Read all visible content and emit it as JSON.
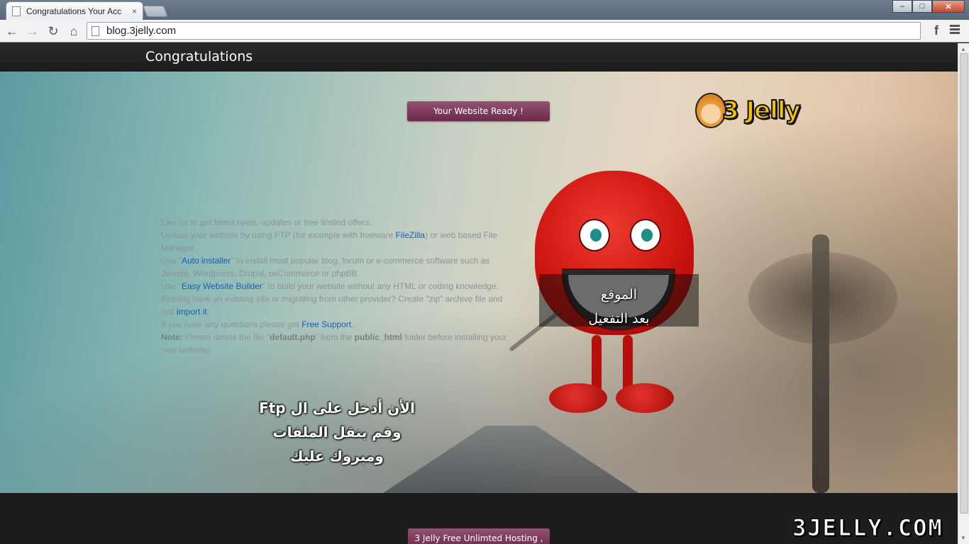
{
  "browser": {
    "tab_title": "Congratulations Your Acc",
    "tab_close": "×",
    "url": "blog.3jelly.com",
    "facebook_icon": "f",
    "window_buttons": {
      "minimize": "–",
      "maximize": "□",
      "close": "✕"
    },
    "nav": {
      "back": "←",
      "forward": "→",
      "reload": "↻",
      "home": "⌂"
    }
  },
  "header": {
    "title": "Congratulations"
  },
  "hero": {
    "ready_button": "Your Website Ready !",
    "logo_text": "3 Jelly",
    "info": {
      "line1": "Like us to get latest news, updates or free limited offers:",
      "upload_pre": "Upload your website by using FTP (for example with freeware ",
      "filezilla": "FileZilla",
      "upload_post": ") or web based File Manager.",
      "use1": "Use \"",
      "auto_installer": "Auto installer",
      "auto_post": "\" to install most popular blog, forum or e-commerce software such as Joomla, Wordpress, Drupal, osCommerce or phpBB.",
      "use2": "Use \"",
      "easy_builder": "Easy Website Builder",
      "builder_post": "\" to build your website without any HTML or coding knowledge.",
      "migrate_pre": "Already have an existing site or migrating from other provider? Create \"zip\" archive file and just ",
      "import_it": "import it",
      "migrate_post": ".",
      "support_pre": "If you have any questions please get ",
      "free_support": "Free Support",
      "support_post": ".",
      "note_label": "Note:",
      "note_pre": " Please delete the file \"",
      "note_file": "default.php",
      "note_mid": "\" from the ",
      "note_folder": "public_html",
      "note_post": " folder before installing your new website!"
    },
    "mouth_line1": "الموقع",
    "mouth_line2": "بعد التفعيل",
    "arabic_line1": "الأن أدخل على ال Ftp",
    "arabic_line2": "وقم بنقل الملفات",
    "arabic_line3": "ومبروك عليك"
  },
  "footer": {
    "hosting_button": "3 Jelly Free Unlimted Hosting ,",
    "watermark": "3JELLY.COM"
  },
  "colors": {
    "accent": "#7d3a58",
    "link": "#1a5fb4",
    "header_bg": "#1d1d1d"
  }
}
